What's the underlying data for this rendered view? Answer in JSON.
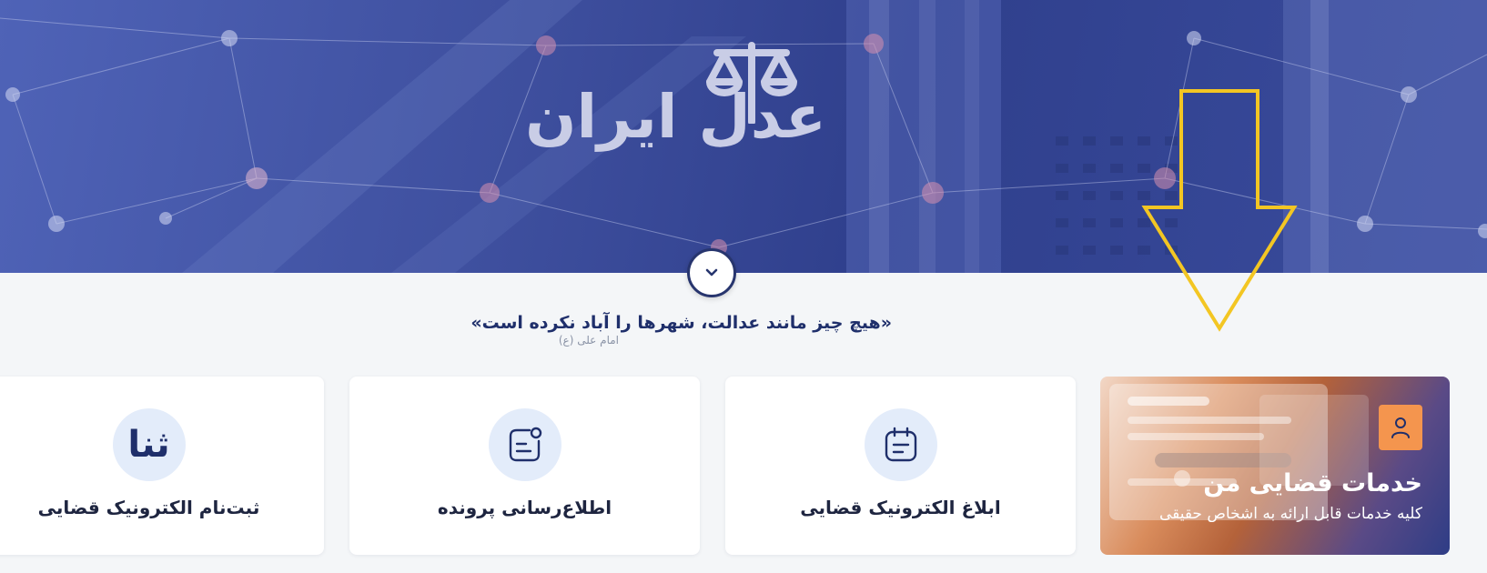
{
  "hero": {
    "brand_text": "عدل ایران"
  },
  "quote": {
    "text": "«هیچ چیز مانند عدالت، شهرها را آباد نکرده است»",
    "author": "امام علی (ع)"
  },
  "feature_card": {
    "title": "خدمات قضایی من",
    "subtitle": "کلیه خدمات قابل ارائه به اشخاص حقیقی",
    "icon": "user-icon"
  },
  "service_cards": [
    {
      "title": "ابلاغ الکترونیک قضایی",
      "icon": "calendar-icon"
    },
    {
      "title": "اطلاع‌رسانی پرونده",
      "icon": "notification-note-icon"
    },
    {
      "title": "ثبت‌نام الکترونیک قضایی",
      "icon": "sana-logo-icon",
      "logo_text": "ثنا"
    }
  ],
  "colors": {
    "hero_blue": "#3e4f9e",
    "navy": "#27356e",
    "icon_bg": "#e3ecfa",
    "accent_orange": "#f4954e",
    "annotation_yellow": "#f3c623"
  }
}
